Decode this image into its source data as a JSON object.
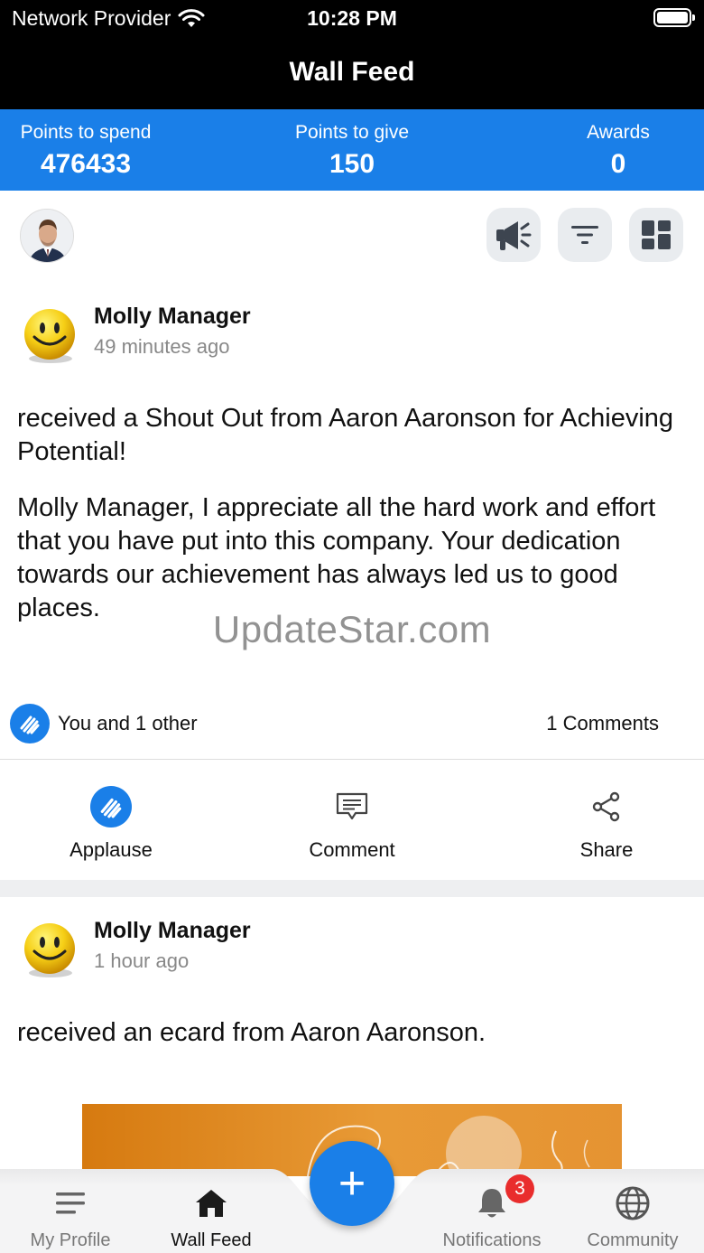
{
  "status_bar": {
    "carrier": "Network Provider",
    "time": "10:28 PM"
  },
  "header": {
    "title": "Wall Feed"
  },
  "points": {
    "spend_label": "Points to spend",
    "spend_value": "476433",
    "give_label": "Points to give",
    "give_value": "150",
    "awards_label": "Awards",
    "awards_value": "0"
  },
  "posts": [
    {
      "author": "Molly Manager",
      "time": "49 minutes ago",
      "headline": "received a Shout Out from Aaron Aaronson for Achieving Potential!",
      "message": "Molly Manager, I appreciate all the hard work and effort that you have put into this company. Your dedication towards our achievement has always led us to good places.",
      "likes": "You and 1 other",
      "comments": "1 Comments"
    },
    {
      "author": "Molly Manager",
      "time": "1 hour ago",
      "headline": "received an ecard from Aaron Aaronson."
    }
  ],
  "actions": {
    "applause": "Applause",
    "comment": "Comment",
    "share": "Share"
  },
  "watermark": "UpdateStar.com",
  "nav": {
    "profile": "My Profile",
    "wall": "Wall Feed",
    "add": "+",
    "notifications": "Notifications",
    "notifications_badge": "3",
    "community": "Community"
  },
  "colors": {
    "accent": "#1a7fe8",
    "header": "#000000",
    "badge": "#e92d2d"
  },
  "icons": [
    "wifi-icon",
    "battery-icon",
    "megaphone-icon",
    "filter-icon",
    "grid-icon",
    "clap-icon",
    "comment-icon",
    "share-icon",
    "menu-icon",
    "home-icon",
    "plus-icon",
    "bell-icon",
    "globe-icon"
  ]
}
